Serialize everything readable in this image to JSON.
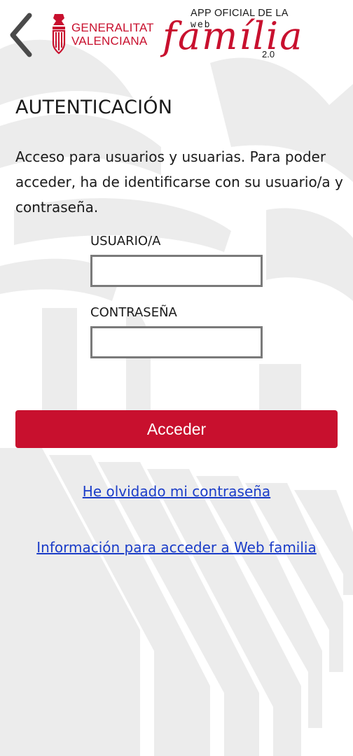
{
  "header": {
    "back_icon": "chevron-left-icon",
    "gv_logo": {
      "line1": "GENERALITAT",
      "line2": "VALENCIANA"
    },
    "wf_logo": {
      "top": "APP OFICIAL DE LA",
      "web": "web",
      "name": "família",
      "version": "2.0"
    }
  },
  "auth": {
    "title": "AUTENTICACIÓN",
    "intro": "Acceso para usuarios y usuarias. Para poder acceder, ha de identificarse con su usuario/a y contraseña.",
    "user_label": "USUARIO/A",
    "user_value": "",
    "password_label": "CONTRASEÑA",
    "password_value": "",
    "submit_label": "Acceder",
    "forgot_link": "He olvidado mi contraseña",
    "info_link": "Información para acceder a Web familia"
  },
  "colors": {
    "brand_red": "#c8102e",
    "link_blue": "#1a3cc8",
    "input_border": "#7a7a7a"
  }
}
